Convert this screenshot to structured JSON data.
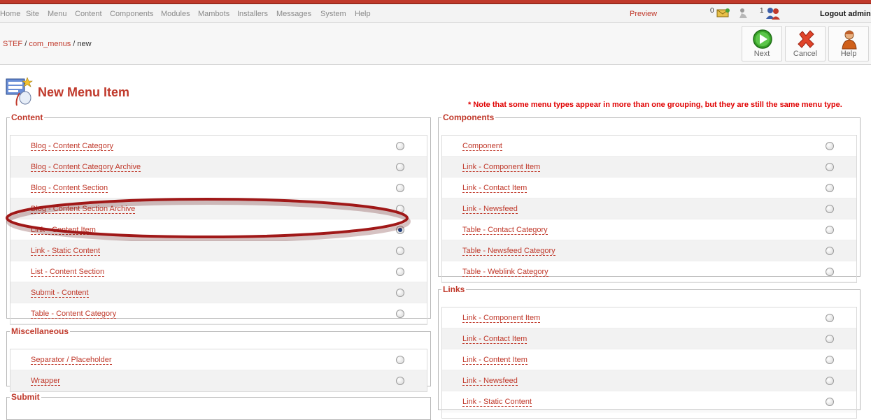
{
  "menu": [
    "Home",
    "Site",
    "Menu",
    "Content",
    "Components",
    "Modules",
    "Mambots",
    "Installers",
    "Messages",
    "System",
    "Help"
  ],
  "topbar": {
    "preview": "Preview",
    "messages_count": "0",
    "users_count": "1",
    "logout": "Logout admin"
  },
  "breadcrumb": {
    "site": "STEF",
    "sep1": "/",
    "component": "com_menus",
    "sep2": "/",
    "current": "new"
  },
  "toolbar": {
    "next": "Next",
    "cancel": "Cancel",
    "help": "Help"
  },
  "page": {
    "title": "New Menu Item",
    "note": "* Note that some menu types appear in more than one grouping, but they are still the same menu type."
  },
  "groups": {
    "content": {
      "legend": "Content",
      "items": [
        "Blog - Content Category",
        "Blog - Content Category Archive",
        "Blog - Content Section",
        "Blog - Content Section Archive",
        "Link - Content Item",
        "Link - Static Content",
        "List - Content Section",
        "Submit - Content",
        "Table - Content Category"
      ]
    },
    "misc": {
      "legend": "Miscellaneous",
      "items": [
        "Separator / Placeholder",
        "Wrapper"
      ]
    },
    "submit": {
      "legend": "Submit"
    },
    "components": {
      "legend": "Components",
      "items": [
        "Component",
        "Link - Component Item",
        "Link - Contact Item",
        "Link - Newsfeed",
        "Table - Contact Category",
        "Table - Newsfeed Category",
        "Table - Weblink Category"
      ]
    },
    "links": {
      "legend": "Links",
      "items": [
        "Link - Component Item",
        "Link - Contact Item",
        "Link - Content Item",
        "Link - Newsfeed",
        "Link - Static Content"
      ]
    }
  },
  "selected": "Link - Content Item",
  "colors": {
    "accent": "#c0392b",
    "note": "#e00000",
    "highlight": "#a01818"
  }
}
